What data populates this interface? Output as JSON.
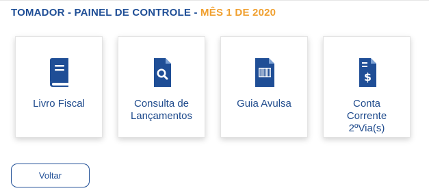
{
  "header": {
    "title_main": "TOMADOR - PAINEL DE CONTROLE -",
    "title_month": "MÊS 1 DE 2020"
  },
  "colors": {
    "primary": "#1f4e96",
    "accent": "#f0a030",
    "card_label": "#1e4a8c"
  },
  "cards": [
    {
      "icon": "book-icon",
      "lines": [
        "Livro Fiscal"
      ]
    },
    {
      "icon": "document-search-icon",
      "lines": [
        "Consulta de",
        "Lançamentos"
      ]
    },
    {
      "icon": "barcode-document-icon",
      "lines": [
        "Guia Avulsa"
      ]
    },
    {
      "icon": "dollar-document-icon",
      "lines": [
        "Conta",
        "Corrente",
        "2ºVia(s)"
      ]
    }
  ],
  "actions": {
    "back_label": "Voltar"
  }
}
